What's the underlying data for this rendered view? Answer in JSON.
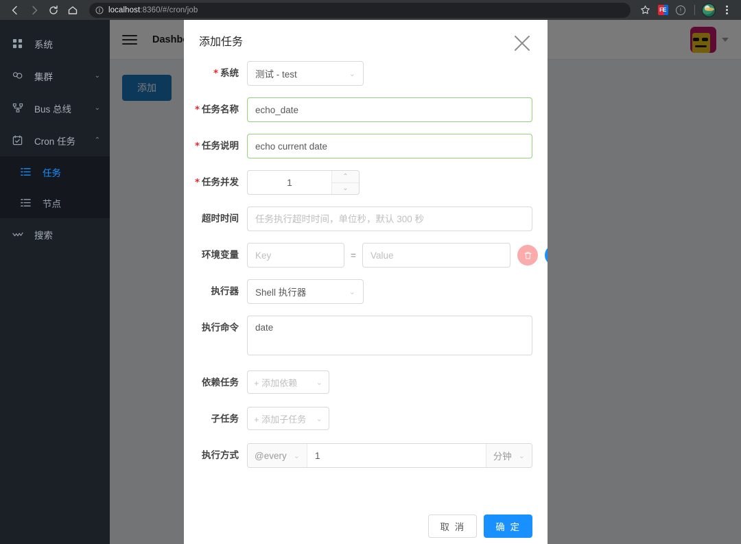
{
  "browser": {
    "url_host": "localhost",
    "url_rest": ":8360/#/cron/job",
    "back_icon": "back-arrow-icon",
    "forward_icon": "forward-arrow-icon",
    "reload_icon": "reload-icon",
    "home_icon": "home-icon",
    "info_icon": "site-info-icon",
    "bookmark_icon": "star-icon",
    "extension_label": "FE",
    "menu_icon": "kebab-menu-icon"
  },
  "sidebar": {
    "items": [
      {
        "label": "系统",
        "icon": "grid-icon",
        "arrow": ""
      },
      {
        "label": "集群",
        "icon": "cluster-icon",
        "arrow": "⌄"
      },
      {
        "label": "Bus 总线",
        "icon": "bus-icon",
        "arrow": "⌄"
      },
      {
        "label": "Cron 任务",
        "icon": "calendar-check-icon",
        "arrow": "⌃"
      }
    ],
    "submenu": [
      {
        "label": "任务",
        "icon": "list-icon",
        "active": true
      },
      {
        "label": "节点",
        "icon": "list-icon",
        "active": false
      }
    ],
    "footer_item": {
      "label": "搜索",
      "icon": "search-icon"
    }
  },
  "topbar": {
    "breadcrumb": "Dashboard",
    "menu_toggle_icon": "hamburger-icon",
    "avatar_icon": "user-avatar",
    "caret_icon": "chevron-down-icon"
  },
  "page": {
    "add_button": "添加"
  },
  "modal": {
    "title": "添加任务",
    "close_icon": "close-icon",
    "fields": {
      "system": {
        "label": "系统",
        "required": true,
        "value": "测试 - test"
      },
      "job_name": {
        "label": "任务名称",
        "required": true,
        "value": "echo_date"
      },
      "job_desc": {
        "label": "任务说明",
        "required": true,
        "value": "echo current date"
      },
      "concurrency": {
        "label": "任务并发",
        "required": true,
        "value": "1"
      },
      "timeout": {
        "label": "超时时间",
        "required": false,
        "placeholder": "任务执行超时时间，单位秒，默认 300 秒",
        "value": ""
      },
      "env": {
        "label": "环境变量",
        "key_placeholder": "Key",
        "key_value": "",
        "equals": "=",
        "value_placeholder": "Value",
        "value_value": "",
        "delete_icon": "trash-icon",
        "add_icon": "plus-icon"
      },
      "executor": {
        "label": "执行器",
        "required": false,
        "value": "Shell 执行器"
      },
      "command": {
        "label": "执行命令",
        "required": false,
        "value": "date"
      },
      "dependency": {
        "label": "依赖任务",
        "required": false,
        "placeholder": "+ 添加依赖"
      },
      "subtask": {
        "label": "子任务",
        "required": false,
        "placeholder": "+ 添加子任务"
      },
      "schedule": {
        "label": "执行方式",
        "prefix": "@every",
        "value": "1",
        "unit": "分钟"
      }
    },
    "footer": {
      "cancel": "取 消",
      "confirm": "确 定"
    }
  },
  "colors": {
    "primary": "#1890ff",
    "sidebar_bg": "#1b2027",
    "valid_border": "#93d07f",
    "required_star": "#f5222d",
    "delete_button": "#fbabab",
    "add_page_button": "#1b75bb"
  }
}
